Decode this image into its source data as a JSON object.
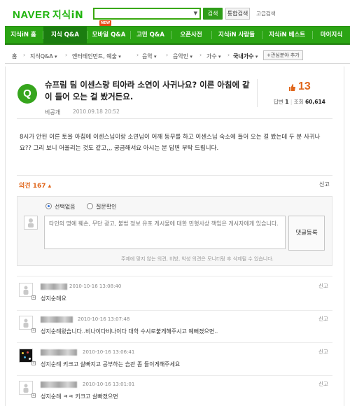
{
  "header": {
    "logo_brand": "NAVER",
    "logo_service": "지식iN",
    "search_placeholder": "",
    "search_button": "검색",
    "combined_search_button": "통합검색",
    "advanced_search_link": "고급검색"
  },
  "nav": {
    "items": [
      {
        "label": "지식iN 홈"
      },
      {
        "label": "지식 Q&A",
        "active": true
      },
      {
        "label": "모바일 Q&A"
      },
      {
        "label": "고민 Q&A"
      },
      {
        "label": "오픈사전"
      },
      {
        "label": "지식iN 사람들"
      },
      {
        "label": "지식iN 베스트"
      },
      {
        "label": "마이지식"
      }
    ],
    "new_badge": "NEW"
  },
  "breadcrumb": {
    "items": [
      "홈",
      "지식Q&A",
      "엔터테인먼트, 예술",
      "음악",
      "음악인",
      "가수",
      "국내가수"
    ],
    "favorite_button": "관심분야 추가"
  },
  "question": {
    "title": "슈프림 팀 이센스랑 티아라 소연이 사귀나요? 이른 아침에 같이 들어 오는 걸 봤거든요.",
    "asker": "비공개",
    "date": "2010.09.18 20:52",
    "likes": "13",
    "answers_label": "답변",
    "answers_count": "1",
    "views_label": "조회",
    "views_count": "60,614",
    "body": "8시가 안된 이른 토욜 아침에 이센스님이랑 소연님이 어깨 동무를 하고 이센스님 숙소에 들어 오는 걸 봤는데 두 분 사귀나요?? 그리 보니 어울리는 것도 같고,,, 궁금해서요 아시는 분 답변 부탁 드립니다."
  },
  "opinions": {
    "label": "의견",
    "count": "167",
    "report": "신고",
    "radio_none": "선택없음",
    "radio_check": "질문확인",
    "input_placeholder": "타인의 명예 훼손, 무단 광고, 불법 정보 유포 게시물에 대한 민형사상 책임은 게시자에게 있습니다.",
    "submit_button": "댓글등록",
    "notice": "주제에 맞지 않는 의견, 비방, 악성 의견은 모니터링 후 삭제될 수 있습니다."
  },
  "comments": [
    {
      "date": "2010-10-16 13:08:40",
      "text": "성지순례요",
      "report": "신고"
    },
    {
      "date": "2010-10-16 13:07:48",
      "text": "성지순례왔습니다..비나이다비나이다 대학 수시로붙게해주시고 예뻐졌으면..",
      "report": "신고"
    },
    {
      "date": "2010-10-16 13:06:41",
      "text": "성지순례 키크고 살빠지고 공부하는 습관 좀 들이게해주세요",
      "report": "신고"
    },
    {
      "date": "2010-10-16 13:01:01",
      "text": "성지순례 ㅋㅋ 키크고 살빠졌으면",
      "report": "신고"
    }
  ],
  "colors": {
    "brand_green": "#2ba414",
    "accent_orange": "#e0661b"
  }
}
